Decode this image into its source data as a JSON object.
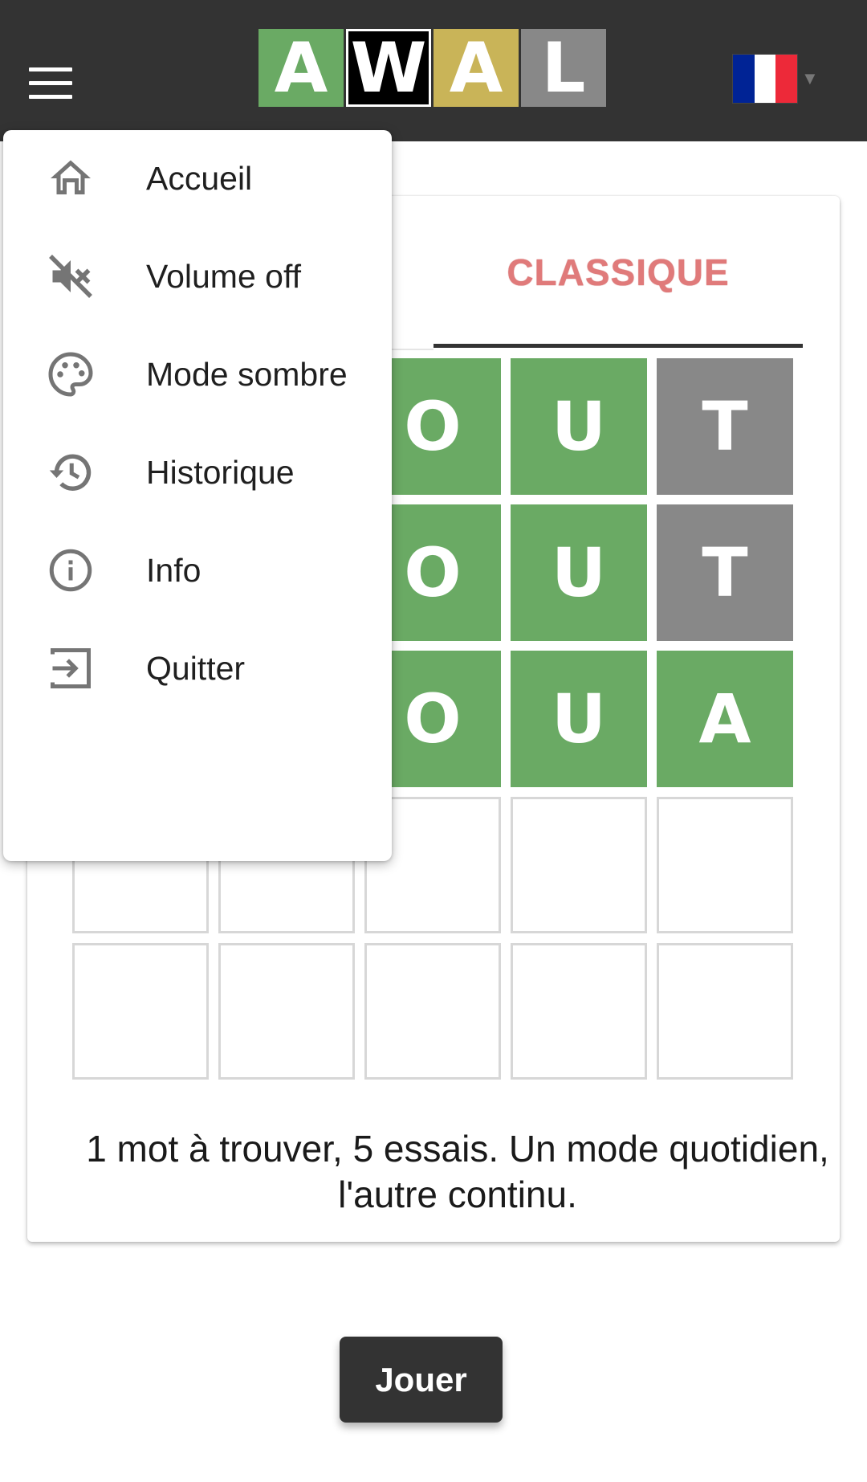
{
  "header": {
    "menu_icon": "hamburger-menu-icon",
    "logo": [
      "A",
      "W",
      "A",
      "L"
    ],
    "logo_colors": [
      "#6aaa64",
      "#000000",
      "#c9b458",
      "#888888"
    ],
    "language_flag": "france-flag-icon",
    "flag_colors": [
      "#002395",
      "#ffffff",
      "#ed2939"
    ]
  },
  "card": {
    "tab_label": "CLASSIQUE",
    "grid": [
      [
        {
          "l": "",
          "s": "hidden"
        },
        {
          "l": "",
          "s": "hidden"
        },
        {
          "l": "O",
          "s": "correct"
        },
        {
          "l": "U",
          "s": "correct"
        },
        {
          "l": "T",
          "s": "absent"
        }
      ],
      [
        {
          "l": "",
          "s": "hidden"
        },
        {
          "l": "",
          "s": "hidden"
        },
        {
          "l": "O",
          "s": "correct"
        },
        {
          "l": "U",
          "s": "correct"
        },
        {
          "l": "T",
          "s": "absent"
        }
      ],
      [
        {
          "l": "",
          "s": "hidden"
        },
        {
          "l": "",
          "s": "hidden"
        },
        {
          "l": "O",
          "s": "correct"
        },
        {
          "l": "U",
          "s": "correct"
        },
        {
          "l": "A",
          "s": "correct"
        }
      ],
      [
        {
          "l": "",
          "s": "empty"
        },
        {
          "l": "",
          "s": "empty"
        },
        {
          "l": "",
          "s": "empty"
        },
        {
          "l": "",
          "s": "empty"
        },
        {
          "l": "",
          "s": "empty"
        }
      ],
      [
        {
          "l": "",
          "s": "empty"
        },
        {
          "l": "",
          "s": "empty"
        },
        {
          "l": "",
          "s": "empty"
        },
        {
          "l": "",
          "s": "empty"
        },
        {
          "l": "",
          "s": "empty"
        }
      ]
    ],
    "colors": {
      "correct": "#6aaa64",
      "absent": "#888888"
    },
    "description": "1 mot à trouver, 5 essais. Un mode quotidien, l'autre continu."
  },
  "menu": {
    "items": [
      {
        "label": "Accueil",
        "icon": "home-icon"
      },
      {
        "label": "Volume off",
        "icon": "volume-off-icon"
      },
      {
        "label": "Mode sombre",
        "icon": "palette-icon"
      },
      {
        "label": "Historique",
        "icon": "history-icon"
      },
      {
        "label": "Info",
        "icon": "info-icon"
      },
      {
        "label": "Quitter",
        "icon": "exit-icon"
      }
    ]
  },
  "play_button": {
    "label": "Jouer"
  }
}
